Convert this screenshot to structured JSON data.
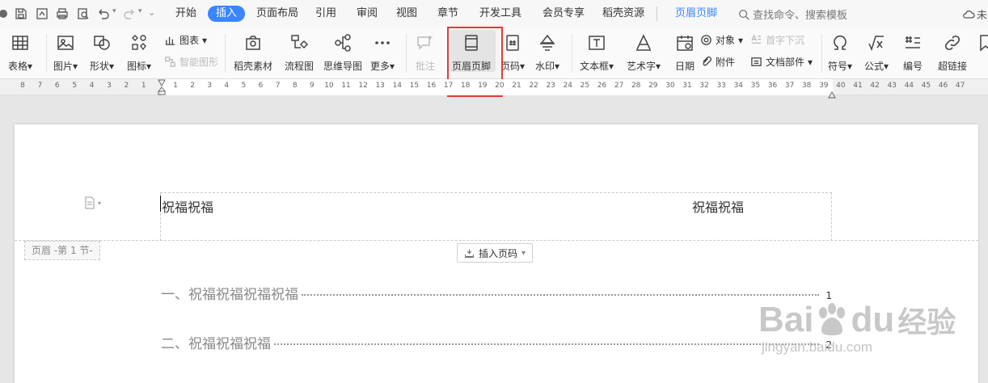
{
  "menubar": {
    "tabs": [
      "开始",
      "插入",
      "页面布局",
      "引用",
      "审阅",
      "视图",
      "章节",
      "开发工具",
      "会员专享",
      "稻壳资源"
    ],
    "active_tab": "插入",
    "context_tab": "页眉页脚",
    "search_placeholder": "查找命令、搜索模板",
    "cloud_label": "未",
    "accent_color": "#3a86ff"
  },
  "ribbon": {
    "table": "表格",
    "picture": "图片",
    "shape": "形状",
    "icon": "图标",
    "chart": "图表",
    "smart_art": "智能图形",
    "docer_material": "稻壳素材",
    "flowchart": "流程图",
    "mindmap": "思维导图",
    "more": "更多",
    "comment": "批注",
    "header_footer": "页眉页脚",
    "page_number": "页码",
    "watermark": "水印",
    "textbox": "文本框",
    "wordart": "艺术字",
    "date": "日期",
    "object": "对象",
    "attachment": "附件",
    "dropcap": "首字下沉",
    "doc_parts": "文档部件",
    "symbol": "符号",
    "formula": "公式",
    "numbering": "编号",
    "hyperlink": "超链接",
    "highlight_color": "#e53935"
  },
  "ruler": {
    "left_ticks": [
      "8",
      "7",
      "6",
      "5",
      "4",
      "3",
      "2",
      "1"
    ],
    "right_ticks": [
      "2",
      "4",
      "6",
      "8",
      "10",
      "12",
      "14",
      "16",
      "18",
      "20",
      "22",
      "24",
      "26",
      "28",
      "30",
      "32",
      "34",
      "36",
      "38",
      "40",
      "42",
      "44",
      "46"
    ],
    "right_ticks_display": [
      "1",
      "2",
      "3",
      "4",
      "5",
      "6",
      "7",
      "8",
      "9",
      "10",
      "11",
      "12",
      "13",
      "14",
      "15",
      "16",
      "17",
      "18",
      "19",
      "20",
      "21",
      "22",
      "23",
      "24",
      "25",
      "26",
      "27",
      "28",
      "29",
      "30",
      "31",
      "32",
      "33",
      "34",
      "35",
      "36",
      "37",
      "38",
      "39",
      "40",
      "41",
      "42",
      "43",
      "44",
      "45",
      "46",
      "47"
    ]
  },
  "document": {
    "header_left": "祝福祝福",
    "header_right": "祝福祝福",
    "header_tag": "页眉  -第 1 节-",
    "insert_page_number": "插入页码",
    "toc": [
      {
        "num": "一、",
        "text": "祝福祝福祝福祝福",
        "page": "1"
      },
      {
        "num": "二、",
        "text": "祝福祝福祝福",
        "page": "2"
      }
    ]
  },
  "watermark": {
    "logo_text": "Bai",
    "logo_text2": "du",
    "logo_cn": "经验",
    "url": "jingyan.baidu.com"
  }
}
